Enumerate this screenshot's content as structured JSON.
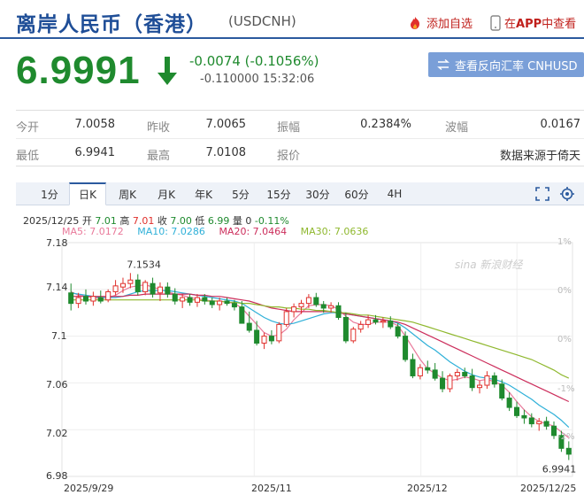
{
  "header": {
    "title": "离岸人民币（香港）",
    "code": "(USDCNH)",
    "favorite_label": "添加自选",
    "app_prefix": "在",
    "app_bold": "APP",
    "app_suffix": "中查看"
  },
  "quote": {
    "price": "6.9991",
    "change": "-0.0074 (-0.1056%)",
    "sub_change": "-0.110000",
    "time": "15:32:06",
    "reverse_label": "查看反向汇率 CNHUSD"
  },
  "stats": [
    {
      "label": "今开",
      "value": "7.0058"
    },
    {
      "label": "昨收",
      "value": "7.0065"
    },
    {
      "label": "振幅",
      "value": "0.2384%"
    },
    {
      "label": "波幅",
      "value": "0.0167"
    },
    {
      "label": "最低",
      "value": "6.9941"
    },
    {
      "label": "最高",
      "value": "7.0108"
    },
    {
      "label": "报价",
      "value": ""
    },
    {
      "label": "",
      "value": "数据来源于倚天"
    }
  ],
  "tabs": [
    "1分",
    "日K",
    "周K",
    "月K",
    "年K",
    "5分",
    "15分",
    "30分",
    "60分",
    "4H"
  ],
  "active_tab": 1,
  "ohlc": {
    "date": "2025/12/25",
    "open_label": "开",
    "open": "7.01",
    "high_label": "高",
    "high": "7.01",
    "close_label": "收",
    "close": "7.00",
    "low_label": "低",
    "low": "6.99",
    "vol_label": "量",
    "vol": "0",
    "pct": "-0.11%"
  },
  "ma": [
    {
      "text": "MA5: 7.0172",
      "color": "#e9799a"
    },
    {
      "text": "MA10: 7.0286",
      "color": "#2fb0d8"
    },
    {
      "text": "MA20: 7.0464",
      "color": "#cc2e5c"
    },
    {
      "text": "MA30: 7.0636",
      "color": "#8fb82e"
    }
  ],
  "colors": {
    "up": "#e0302c",
    "down": "#1f8a2e",
    "accent": "#2b5a9e"
  },
  "watermark": "sina 新浪财经",
  "chart_data": {
    "type": "candlestick",
    "y_ticks": [
      "7.18",
      "7.14",
      "7.1",
      "7.06",
      "7.02",
      "6.98"
    ],
    "ylim": [
      6.98,
      7.18
    ],
    "pct_ticks": [
      "1%",
      "0%",
      "0%",
      "-1%",
      "-2%"
    ],
    "x_ticks": [
      "2025/9/29",
      "2025/11",
      "2025/12",
      "2025/12/25"
    ],
    "annotations": [
      {
        "text": "7.1534"
      },
      {
        "text": "6.9941"
      }
    ],
    "candles": [
      [
        7.137,
        7.145,
        7.122,
        7.128
      ],
      [
        7.128,
        7.137,
        7.124,
        7.133
      ],
      [
        7.134,
        7.14,
        7.127,
        7.13
      ],
      [
        7.13,
        7.138,
        7.126,
        7.134
      ],
      [
        7.133,
        7.139,
        7.128,
        7.13
      ],
      [
        7.131,
        7.14,
        7.129,
        7.138
      ],
      [
        7.138,
        7.148,
        7.135,
        7.143
      ],
      [
        7.142,
        7.15,
        7.137,
        7.145
      ],
      [
        7.145,
        7.154,
        7.141,
        7.148
      ],
      [
        7.148,
        7.153,
        7.135,
        7.138
      ],
      [
        7.138,
        7.148,
        7.135,
        7.146
      ],
      [
        7.145,
        7.15,
        7.133,
        7.136
      ],
      [
        7.137,
        7.146,
        7.13,
        7.142
      ],
      [
        7.142,
        7.146,
        7.133,
        7.136
      ],
      [
        7.136,
        7.141,
        7.127,
        7.13
      ],
      [
        7.13,
        7.136,
        7.124,
        7.133
      ],
      [
        7.133,
        7.136,
        7.126,
        7.129
      ],
      [
        7.129,
        7.136,
        7.125,
        7.133
      ],
      [
        7.133,
        7.136,
        7.127,
        7.13
      ],
      [
        7.13,
        7.133,
        7.124,
        7.127
      ],
      [
        7.127,
        7.133,
        7.122,
        7.13
      ],
      [
        7.13,
        7.133,
        7.126,
        7.128
      ],
      [
        7.128,
        7.131,
        7.122,
        7.125
      ],
      [
        7.125,
        7.13,
        7.117,
        7.111
      ],
      [
        7.111,
        7.121,
        7.103,
        7.105
      ],
      [
        7.105,
        7.113,
        7.092,
        7.094
      ],
      [
        7.094,
        7.103,
        7.089,
        7.1
      ],
      [
        7.1,
        7.105,
        7.093,
        7.096
      ],
      [
        7.096,
        7.112,
        7.094,
        7.11
      ],
      [
        7.11,
        7.124,
        7.108,
        7.121
      ],
      [
        7.121,
        7.128,
        7.116,
        7.125
      ],
      [
        7.125,
        7.131,
        7.119,
        7.128
      ],
      [
        7.128,
        7.136,
        7.124,
        7.133
      ],
      [
        7.133,
        7.137,
        7.125,
        7.127
      ],
      [
        7.127,
        7.13,
        7.12,
        7.124
      ],
      [
        7.124,
        7.129,
        7.12,
        7.126
      ],
      [
        7.126,
        7.129,
        7.114,
        7.116
      ],
      [
        7.116,
        7.12,
        7.094,
        7.096
      ],
      [
        7.096,
        7.108,
        7.094,
        7.106
      ],
      [
        7.106,
        7.113,
        7.103,
        7.11
      ],
      [
        7.11,
        7.118,
        7.107,
        7.114
      ],
      [
        7.114,
        7.118,
        7.11,
        7.112
      ],
      [
        7.112,
        7.116,
        7.107,
        7.113
      ],
      [
        7.113,
        7.117,
        7.106,
        7.108
      ],
      [
        7.108,
        7.111,
        7.098,
        7.1
      ],
      [
        7.1,
        7.104,
        7.078,
        7.08
      ],
      [
        7.08,
        7.085,
        7.064,
        7.066
      ],
      [
        7.066,
        7.076,
        7.063,
        7.073
      ],
      [
        7.073,
        7.079,
        7.068,
        7.071
      ],
      [
        7.071,
        7.077,
        7.062,
        7.064
      ],
      [
        7.064,
        7.07,
        7.052,
        7.055
      ],
      [
        7.055,
        7.068,
        7.052,
        7.066
      ],
      [
        7.066,
        7.072,
        7.062,
        7.069
      ],
      [
        7.069,
        7.073,
        7.064,
        7.066
      ],
      [
        7.066,
        7.072,
        7.053,
        7.056
      ],
      [
        7.056,
        7.062,
        7.051,
        7.058
      ],
      [
        7.058,
        7.07,
        7.055,
        7.066
      ],
      [
        7.066,
        7.069,
        7.056,
        7.059
      ],
      [
        7.059,
        7.063,
        7.045,
        7.047
      ],
      [
        7.047,
        7.052,
        7.036,
        7.039
      ],
      [
        7.039,
        7.044,
        7.03,
        7.032
      ],
      [
        7.032,
        7.037,
        7.025,
        7.03
      ],
      [
        7.03,
        7.034,
        7.022,
        7.025
      ],
      [
        7.025,
        7.03,
        7.019,
        7.027
      ],
      [
        7.027,
        7.031,
        7.02,
        7.023
      ],
      [
        7.023,
        7.027,
        7.012,
        7.015
      ],
      [
        7.015,
        7.019,
        7.001,
        7.004
      ],
      [
        7.004,
        7.01,
        6.994,
        6.999
      ]
    ],
    "ma_series": [
      {
        "name": "MA5",
        "values": [
          7.138,
          7.135,
          7.134,
          7.133,
          7.132,
          7.133,
          7.135,
          7.139,
          7.142,
          7.143,
          7.144,
          7.142,
          7.14,
          7.138,
          7.136,
          7.135,
          7.133,
          7.132,
          7.131,
          7.13,
          7.13,
          7.129,
          7.128,
          7.124,
          7.117,
          7.11,
          7.103,
          7.1,
          7.101,
          7.106,
          7.114,
          7.12,
          7.126,
          7.127,
          7.127,
          7.126,
          7.123,
          7.117,
          7.112,
          7.11,
          7.11,
          7.112,
          7.112,
          7.112,
          7.109,
          7.1,
          7.09,
          7.08,
          7.072,
          7.068,
          7.064,
          7.062,
          7.063,
          7.065,
          7.064,
          7.062,
          7.063,
          7.061,
          7.058,
          7.052,
          7.044,
          7.037,
          7.031,
          7.027,
          7.025,
          7.023,
          7.018,
          7.013
        ]
      },
      {
        "name": "MA10",
        "values": [
          7.137,
          7.136,
          7.135,
          7.134,
          7.133,
          7.133,
          7.133,
          7.134,
          7.136,
          7.138,
          7.139,
          7.139,
          7.139,
          7.139,
          7.138,
          7.137,
          7.136,
          7.135,
          7.134,
          7.133,
          7.132,
          7.131,
          7.13,
          7.128,
          7.124,
          7.12,
          7.116,
          7.113,
          7.111,
          7.11,
          7.111,
          7.113,
          7.115,
          7.117,
          7.119,
          7.12,
          7.12,
          7.119,
          7.118,
          7.117,
          7.116,
          7.115,
          7.114,
          7.113,
          7.111,
          7.107,
          7.102,
          7.097,
          7.092,
          7.088,
          7.083,
          7.078,
          7.074,
          7.07,
          7.067,
          7.065,
          7.064,
          7.063,
          7.061,
          7.058,
          7.054,
          7.05,
          7.046,
          7.041,
          7.037,
          7.033,
          7.028,
          7.022
        ]
      },
      {
        "name": "MA20",
        "values": [
          7.134,
          7.134,
          7.134,
          7.134,
          7.134,
          7.134,
          7.134,
          7.134,
          7.135,
          7.135,
          7.136,
          7.136,
          7.136,
          7.136,
          7.136,
          7.136,
          7.136,
          7.135,
          7.135,
          7.134,
          7.134,
          7.133,
          7.132,
          7.131,
          7.13,
          7.128,
          7.126,
          7.124,
          7.123,
          7.122,
          7.121,
          7.121,
          7.121,
          7.121,
          7.121,
          7.121,
          7.12,
          7.119,
          7.118,
          7.117,
          7.116,
          7.115,
          7.114,
          7.113,
          7.112,
          7.11,
          7.107,
          7.104,
          7.101,
          7.098,
          7.095,
          7.092,
          7.089,
          7.086,
          7.083,
          7.08,
          7.077,
          7.074,
          7.071,
          7.068,
          7.065,
          7.062,
          7.059,
          7.056,
          7.053,
          7.05,
          7.047,
          7.044
        ]
      },
      {
        "name": "MA30",
        "values": [
          7.131,
          7.131,
          7.131,
          7.131,
          7.131,
          7.131,
          7.131,
          7.131,
          7.131,
          7.131,
          7.131,
          7.131,
          7.131,
          7.131,
          7.131,
          7.131,
          7.131,
          7.131,
          7.13,
          7.13,
          7.13,
          7.129,
          7.129,
          7.128,
          7.128,
          7.127,
          7.126,
          7.125,
          7.125,
          7.124,
          7.124,
          7.123,
          7.123,
          7.122,
          7.122,
          7.121,
          7.12,
          7.12,
          7.119,
          7.118,
          7.118,
          7.117,
          7.116,
          7.115,
          7.114,
          7.113,
          7.112,
          7.11,
          7.108,
          7.106,
          7.104,
          7.102,
          7.1,
          7.098,
          7.096,
          7.094,
          7.092,
          7.09,
          7.088,
          7.086,
          7.084,
          7.082,
          7.08,
          7.077,
          7.074,
          7.071,
          7.067,
          7.064
        ]
      }
    ]
  }
}
